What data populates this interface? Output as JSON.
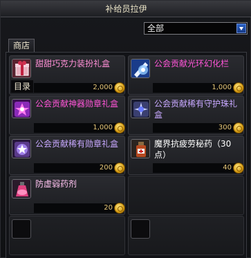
{
  "window": {
    "title": "补给员拉伊",
    "filter": {
      "selected": "全部"
    },
    "tab": "商店",
    "catalog_label": "目录"
  },
  "items": [
    {
      "name": "甜甜巧克力装扮礼盒",
      "price": "2,000",
      "name_color": "#ff8fd6",
      "icon": "chocolate-gift-box-icon"
    },
    {
      "name": "公会贡献光环幻化栏",
      "price": "1,000",
      "name_color": "#ff55d8",
      "icon": "aura-slot-icon"
    },
    {
      "name": "公会贡献神器勋章礼盒",
      "price": "1,000",
      "name_color": "#ff55d8",
      "icon": "artifact-medal-box-icon"
    },
    {
      "name": "公会贡献稀有守护珠礼盒",
      "price": "300",
      "name_color": "#c8a8ff",
      "icon": "guardian-bead-box-icon"
    },
    {
      "name": "公会贡献稀有勋章礼盒",
      "price": "200",
      "name_color": "#c8a8ff",
      "icon": "rare-medal-box-icon"
    },
    {
      "name": "魔界抗疲劳秘药（30点）",
      "price": "40",
      "name_color": "#ffffff",
      "icon": "fatigue-potion-icon"
    },
    {
      "name": "防虚弱药剂",
      "price": "20",
      "name_color": "#ffc2f0",
      "icon": "anti-weakness-potion-icon"
    }
  ],
  "colors": {
    "price": "#e8c878",
    "coin": "#d49b12",
    "dropdown_arrow": "#2b63c7"
  }
}
